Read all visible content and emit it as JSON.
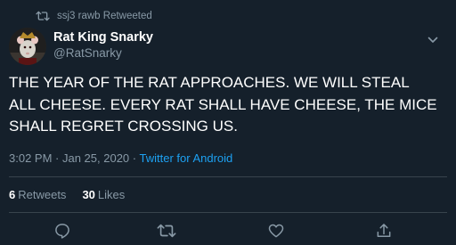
{
  "retweet_banner": {
    "text": "ssj3 rawb Retweeted"
  },
  "author": {
    "name": "Rat King Snarky",
    "handle": "@RatSnarky"
  },
  "tweet": {
    "lines": [
      "THE YEAR OF THE RAT APPROACHES. WE WILL STEAL",
      "ALL CHEESE. EVERY RAT SHALL HAVE CHEESE, THE MICE",
      "SHALL REGRET CROSSING US."
    ]
  },
  "meta": {
    "time": "3:02 PM",
    "separator": " · ",
    "date": "Jan 25, 2020",
    "source": "Twitter for Android"
  },
  "stats": {
    "retweets_count": "6",
    "retweets_label": "Retweets",
    "likes_count": "30",
    "likes_label": "Likes"
  },
  "icons": {
    "retweet_banner": "retweet-icon",
    "caret": "chevron-down-icon",
    "reply": "reply-icon",
    "retweet": "retweet-icon",
    "like": "heart-icon",
    "share": "share-icon"
  },
  "colors": {
    "background": "#15202b",
    "text": "#ffffff",
    "secondary_text": "#8899a6",
    "link": "#1da1f2",
    "divider": "#38444d"
  }
}
